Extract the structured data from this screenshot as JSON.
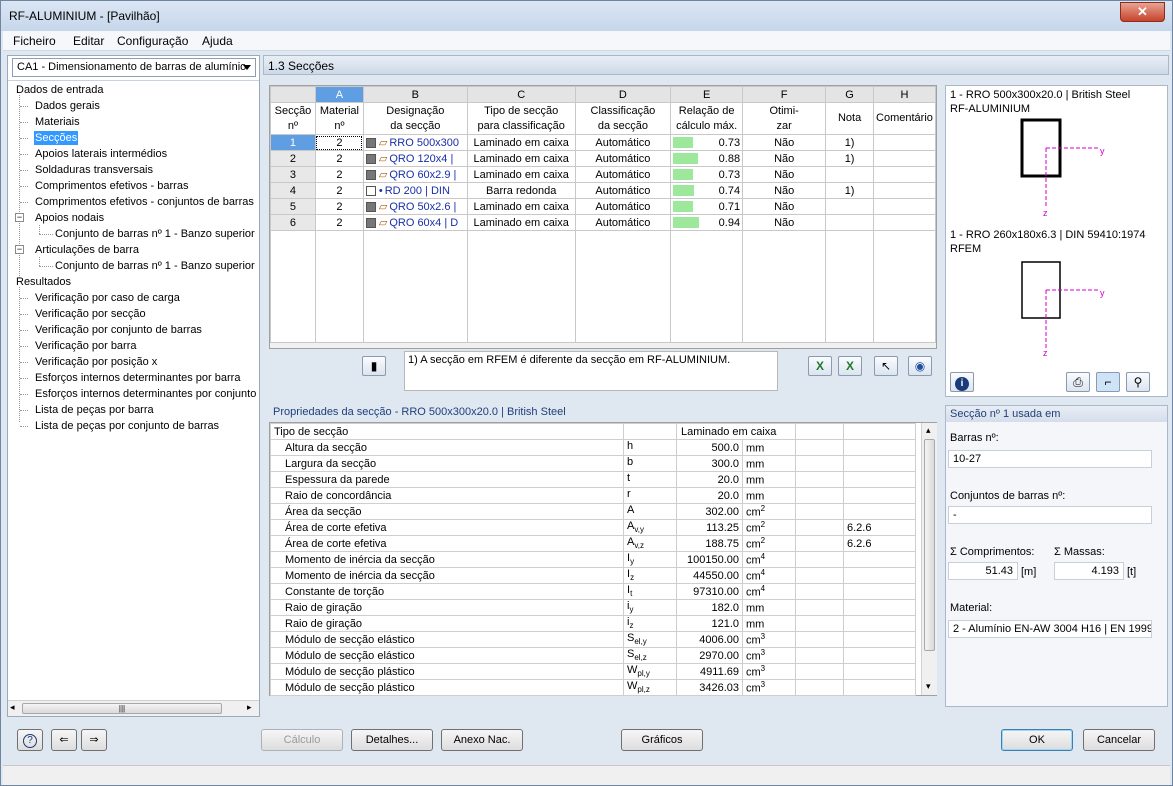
{
  "window": {
    "title": "RF-ALUMINIUM - [Pavilhão]",
    "close_glyph": "✕"
  },
  "menu": [
    "Ficheiro",
    "Editar",
    "Configuração",
    "Ajuda"
  ],
  "module_selector": "CA1 - Dimensionamento de barras de alumínio",
  "tree": {
    "input_root": "Dados de entrada",
    "input_items": [
      "Dados gerais",
      "Materiais",
      "Secções",
      "Apoios laterais intermédios",
      "Soldaduras transversais",
      "Comprimentos efetivos - barras",
      "Comprimentos efetivos - conjuntos de barras",
      "Apoios nodais",
      "Conjunto de barras nº 1 - Banzo superior",
      "Articulações de barra",
      "Conjunto de barras nº 1 - Banzo superior"
    ],
    "results_root": "Resultados",
    "results_items": [
      "Verificação por caso de carga",
      "Verificação por secção",
      "Verificação por conjunto de barras",
      "Verificação por barra",
      "Verificação por posição x",
      "Esforços internos determinantes por barra",
      "Esforços internos determinantes por conjunto",
      "Lista de peças por barra",
      "Lista de peças por conjunto de barras"
    ],
    "selected": "Secções"
  },
  "section_header": "1.3 Secções",
  "table": {
    "col_letters": [
      "A",
      "B",
      "C",
      "D",
      "E",
      "F",
      "G",
      "H"
    ],
    "headers": [
      [
        "Secção",
        "nº"
      ],
      [
        "Material",
        "nº"
      ],
      [
        "Designação",
        "da secção"
      ],
      [
        "Tipo de secção",
        "para classificação"
      ],
      [
        "Classificação",
        "da secção"
      ],
      [
        "Relação de",
        "cálculo máx."
      ],
      [
        "Otimi-",
        "zar"
      ],
      [
        "",
        "Nota"
      ],
      [
        "",
        "Comentário"
      ]
    ],
    "rows": [
      {
        "no": "1",
        "mat": "2",
        "desig": "RRO 500x300",
        "tipo": "Laminado em caixa",
        "class": "Automático",
        "ratio": "0.73",
        "ratio_val": 0.73,
        "opt": "Não",
        "nota": "1)",
        "com": ""
      },
      {
        "no": "2",
        "mat": "2",
        "desig": "QRO 120x4 |",
        "tipo": "Laminado em caixa",
        "class": "Automático",
        "ratio": "0.88",
        "ratio_val": 0.88,
        "opt": "Não",
        "nota": "1)",
        "com": ""
      },
      {
        "no": "3",
        "mat": "2",
        "desig": "QRO 60x2.9 |",
        "tipo": "Laminado em caixa",
        "class": "Automático",
        "ratio": "0.73",
        "ratio_val": 0.73,
        "opt": "Não",
        "nota": "",
        "com": ""
      },
      {
        "no": "4",
        "mat": "2",
        "desig": "RD 200 | DIN",
        "tipo": "Barra redonda",
        "class": "Automático",
        "ratio": "0.74",
        "ratio_val": 0.74,
        "opt": "Não",
        "nota": "1)",
        "com": ""
      },
      {
        "no": "5",
        "mat": "2",
        "desig": "QRO 50x2.6 |",
        "tipo": "Laminado em caixa",
        "class": "Automático",
        "ratio": "0.71",
        "ratio_val": 0.71,
        "opt": "Não",
        "nota": "",
        "com": ""
      },
      {
        "no": "6",
        "mat": "2",
        "desig": "QRO 60x4 | D",
        "tipo": "Laminado em caixa",
        "class": "Automático",
        "ratio": "0.94",
        "ratio_val": 0.94,
        "opt": "Não",
        "nota": "",
        "com": ""
      }
    ],
    "note": "1) A secção em RFEM é diferente da secção em RF-ALUMINIUM."
  },
  "preview": {
    "line1": "1 - RRO 500x300x20.0 | British Steel",
    "line2": "RF-ALUMINIUM",
    "line3": "1 - RRO 260x180x6.3 | DIN 59410:1974",
    "line4": "RFEM",
    "axis_y": "y",
    "axis_z": "z"
  },
  "props": {
    "title": "Propriedades da secção  -  RRO 500x300x20.0 | British Steel",
    "header": {
      "name": "Tipo de secção",
      "value": "Laminado em caixa"
    },
    "rows": [
      {
        "name": "Altura da secção",
        "sym": "h",
        "sub": "",
        "val": "500.0",
        "unit": "mm",
        "sup": "",
        "ref": ""
      },
      {
        "name": "Largura da secção",
        "sym": "b",
        "sub": "",
        "val": "300.0",
        "unit": "mm",
        "sup": "",
        "ref": ""
      },
      {
        "name": "Espessura da parede",
        "sym": "t",
        "sub": "",
        "val": "20.0",
        "unit": "mm",
        "sup": "",
        "ref": ""
      },
      {
        "name": "Raio de concordância",
        "sym": "r",
        "sub": "",
        "val": "20.0",
        "unit": "mm",
        "sup": "",
        "ref": ""
      },
      {
        "name": "Área da secção",
        "sym": "A",
        "sub": "",
        "val": "302.00",
        "unit": "cm",
        "sup": "2",
        "ref": ""
      },
      {
        "name": "Área de corte efetiva",
        "sym": "A",
        "sub": "v,y",
        "val": "113.25",
        "unit": "cm",
        "sup": "2",
        "ref": "6.2.6"
      },
      {
        "name": "Área de corte efetiva",
        "sym": "A",
        "sub": "v,z",
        "val": "188.75",
        "unit": "cm",
        "sup": "2",
        "ref": "6.2.6"
      },
      {
        "name": "Momento de inércia da secção",
        "sym": "I",
        "sub": "y",
        "val": "100150.00",
        "unit": "cm",
        "sup": "4",
        "ref": ""
      },
      {
        "name": "Momento de inércia da secção",
        "sym": "I",
        "sub": "z",
        "val": "44550.00",
        "unit": "cm",
        "sup": "4",
        "ref": ""
      },
      {
        "name": "Constante de torção",
        "sym": "I",
        "sub": "t",
        "val": "97310.00",
        "unit": "cm",
        "sup": "4",
        "ref": ""
      },
      {
        "name": "Raio de giração",
        "sym": "i",
        "sub": "y",
        "val": "182.0",
        "unit": "mm",
        "sup": "",
        "ref": ""
      },
      {
        "name": "Raio de giração",
        "sym": "i",
        "sub": "z",
        "val": "121.0",
        "unit": "mm",
        "sup": "",
        "ref": ""
      },
      {
        "name": "Módulo de secção elástico",
        "sym": "S",
        "sub": "el,y",
        "val": "4006.00",
        "unit": "cm",
        "sup": "3",
        "ref": ""
      },
      {
        "name": "Módulo de secção elástico",
        "sym": "S",
        "sub": "el,z",
        "val": "2970.00",
        "unit": "cm",
        "sup": "3",
        "ref": ""
      },
      {
        "name": "Módulo de secção plástico",
        "sym": "W",
        "sub": "pl,y",
        "val": "4911.69",
        "unit": "cm",
        "sup": "3",
        "ref": ""
      },
      {
        "name": "Módulo de secção plástico",
        "sym": "W",
        "sub": "pl,z",
        "val": "3426.03",
        "unit": "cm",
        "sup": "3",
        "ref": ""
      }
    ]
  },
  "used": {
    "title": "Secção nº 1 usada em",
    "barras_label": "Barras nº:",
    "barras": "10-27",
    "conj_label": "Conjuntos de barras nº:",
    "conj": "-",
    "comp_label": "Σ Comprimentos:",
    "massas_label": "Σ Massas:",
    "comp": "51.43",
    "comp_unit": "[m]",
    "massas": "4.193",
    "massas_unit": "[t]",
    "mat_label": "Material:",
    "mat": "2 - Alumínio EN-AW 3004 H16 | EN 1999-"
  },
  "buttons": {
    "calc": "Cálculo",
    "details": "Detalhes...",
    "annex": "Anexo Nac.",
    "graphics": "Gráficos",
    "ok": "OK",
    "cancel": "Cancelar"
  },
  "icons": {
    "help": "?",
    "info": "i",
    "export_left": "⇐",
    "export_right": "⇒",
    "scroll_left": "◂",
    "scroll_right": "▸",
    "scroll_up": "▴",
    "scroll_down": "▾",
    "grip": "|||",
    "excel_import": "X",
    "excel_export": "X",
    "pick": "↖",
    "view": "◉",
    "book": "▮",
    "print": "⎙",
    "axes": "⌐",
    "zoom": "⚲"
  }
}
